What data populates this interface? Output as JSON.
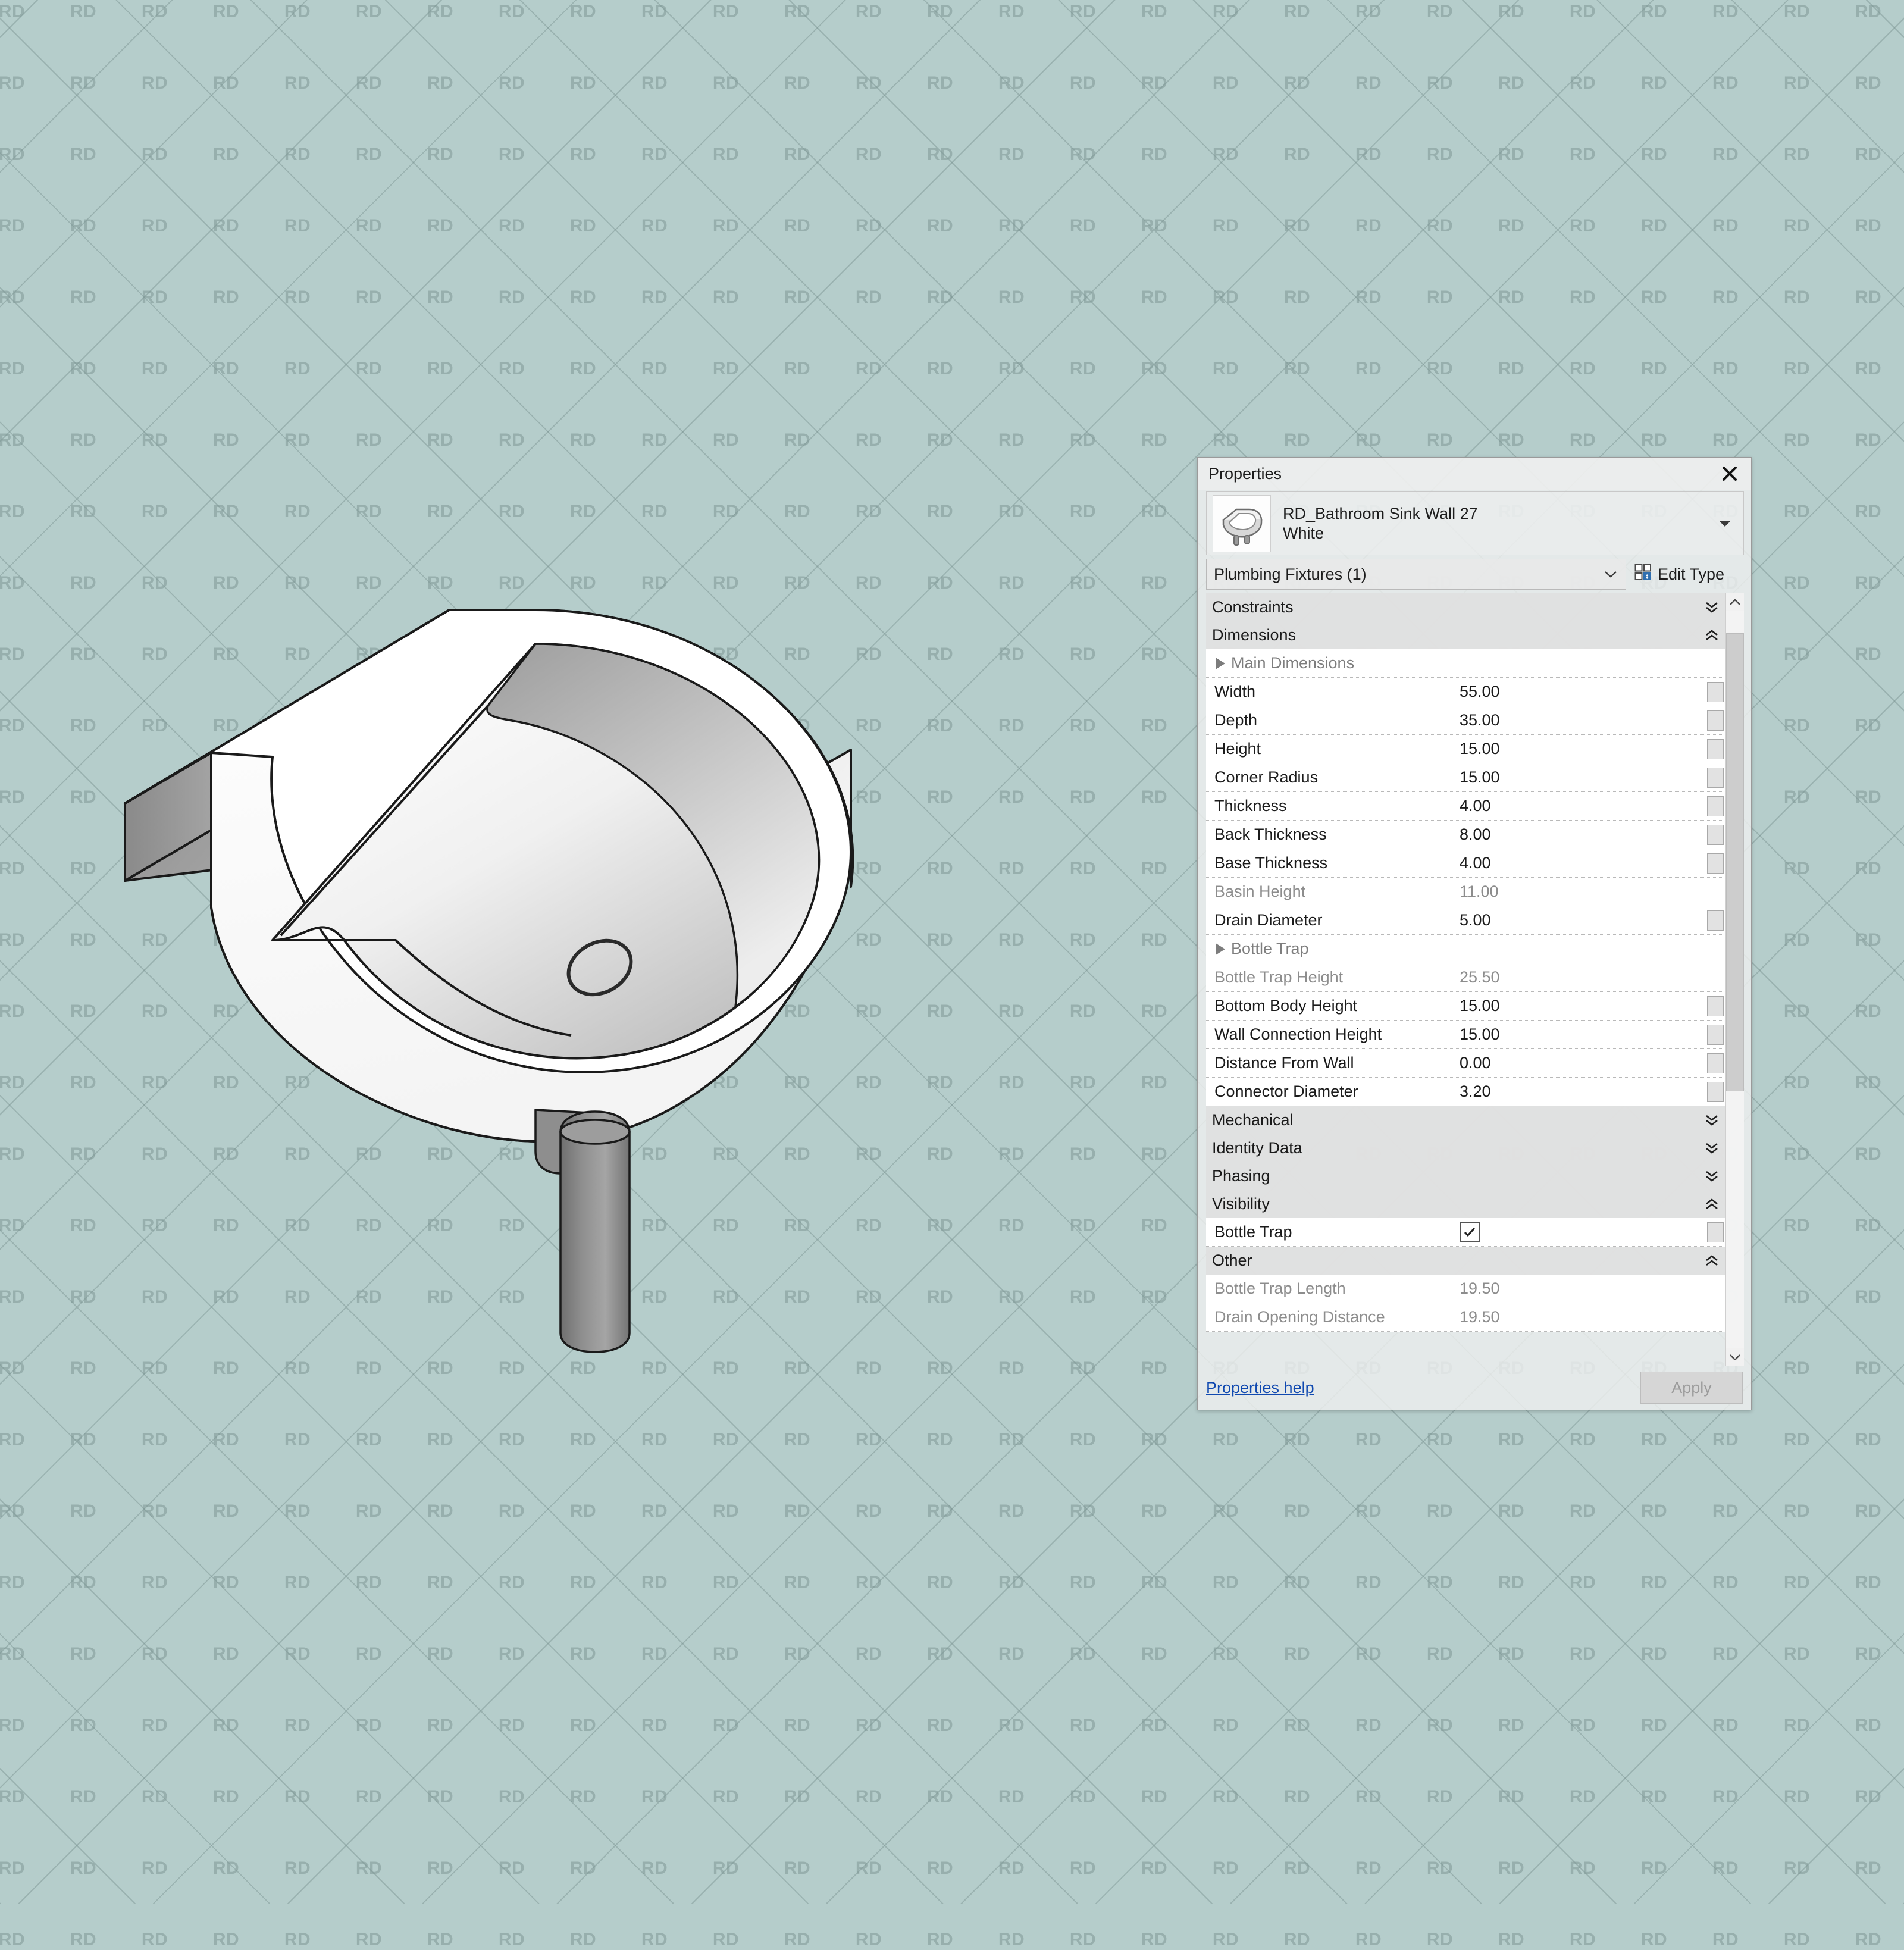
{
  "background": {
    "watermark_text": "RD",
    "color": "#b5cdcb"
  },
  "viewport": {
    "object_name": "RD_Bathroom Sink Wall 27 White",
    "view_label": "3d-sink-view"
  },
  "panel": {
    "title": "Properties",
    "close_icon": "close-icon",
    "type_name_line1": "RD_Bathroom Sink Wall 27",
    "type_name_line2": "White",
    "type_dropdown_icon": "chevron-down-icon",
    "thumbnail_icon": "sink-thumbnail",
    "category_selector": "Plumbing Fixtures (1)",
    "category_dropdown_icon": "chevron-down-icon",
    "edit_type_label": "Edit Type",
    "edit_type_icon": "edit-type-grid-icon",
    "help_label": "Properties help",
    "apply_label": "Apply",
    "apply_disabled": true,
    "scrollbar": {
      "up_icon": "chevron-up-icon",
      "down_icon": "chevron-down-icon"
    },
    "groups": [
      {
        "label": "Constraints",
        "expanded": false,
        "chevron": "double-chevron-down-icon",
        "rows": []
      },
      {
        "label": "Dimensions",
        "expanded": true,
        "chevron": "double-chevron-up-icon",
        "rows": [
          {
            "label": "Main Dimensions",
            "value": "",
            "kind": "subheader",
            "readonly": true,
            "expander": "triangle-right-icon"
          },
          {
            "label": "Width",
            "value": "55.00",
            "kind": "value",
            "readonly": false
          },
          {
            "label": "Depth",
            "value": "35.00",
            "kind": "value",
            "readonly": false
          },
          {
            "label": "Height",
            "value": "15.00",
            "kind": "value",
            "readonly": false
          },
          {
            "label": "Corner Radius",
            "value": "15.00",
            "kind": "value",
            "readonly": false
          },
          {
            "label": "Thickness",
            "value": "4.00",
            "kind": "value",
            "readonly": false
          },
          {
            "label": "Back Thickness",
            "value": "8.00",
            "kind": "value",
            "readonly": false
          },
          {
            "label": "Base Thickness",
            "value": "4.00",
            "kind": "value",
            "readonly": false
          },
          {
            "label": "Basin Height",
            "value": "11.00",
            "kind": "value",
            "readonly": true
          },
          {
            "label": "Drain Diameter",
            "value": "5.00",
            "kind": "value",
            "readonly": false
          },
          {
            "label": "Bottle Trap",
            "value": "",
            "kind": "subheader",
            "readonly": true,
            "expander": "triangle-right-icon"
          },
          {
            "label": "Bottle Trap Height",
            "value": "25.50",
            "kind": "value",
            "readonly": true
          },
          {
            "label": "Bottom Body Height",
            "value": "15.00",
            "kind": "value",
            "readonly": false
          },
          {
            "label": "Wall Connection Height",
            "value": "15.00",
            "kind": "value",
            "readonly": false
          },
          {
            "label": "Distance From Wall",
            "value": "0.00",
            "kind": "value",
            "readonly": false
          },
          {
            "label": "Connector Diameter",
            "value": "3.20",
            "kind": "value",
            "readonly": false
          }
        ]
      },
      {
        "label": "Mechanical",
        "expanded": false,
        "chevron": "double-chevron-down-icon",
        "rows": []
      },
      {
        "label": "Identity Data",
        "expanded": false,
        "chevron": "double-chevron-down-icon",
        "rows": []
      },
      {
        "label": "Phasing",
        "expanded": false,
        "chevron": "double-chevron-down-icon",
        "rows": []
      },
      {
        "label": "Visibility",
        "expanded": true,
        "chevron": "double-chevron-up-icon",
        "rows": [
          {
            "label": "Bottle Trap",
            "value": "",
            "kind": "checkbox",
            "checked": true,
            "readonly": false
          }
        ]
      },
      {
        "label": "Other",
        "expanded": true,
        "chevron": "double-chevron-up-icon",
        "rows": [
          {
            "label": "Bottle Trap Length",
            "value": "19.50",
            "kind": "value",
            "readonly": true
          },
          {
            "label": "Drain Opening Distance",
            "value": "19.50",
            "kind": "value",
            "readonly": true
          }
        ]
      }
    ]
  }
}
